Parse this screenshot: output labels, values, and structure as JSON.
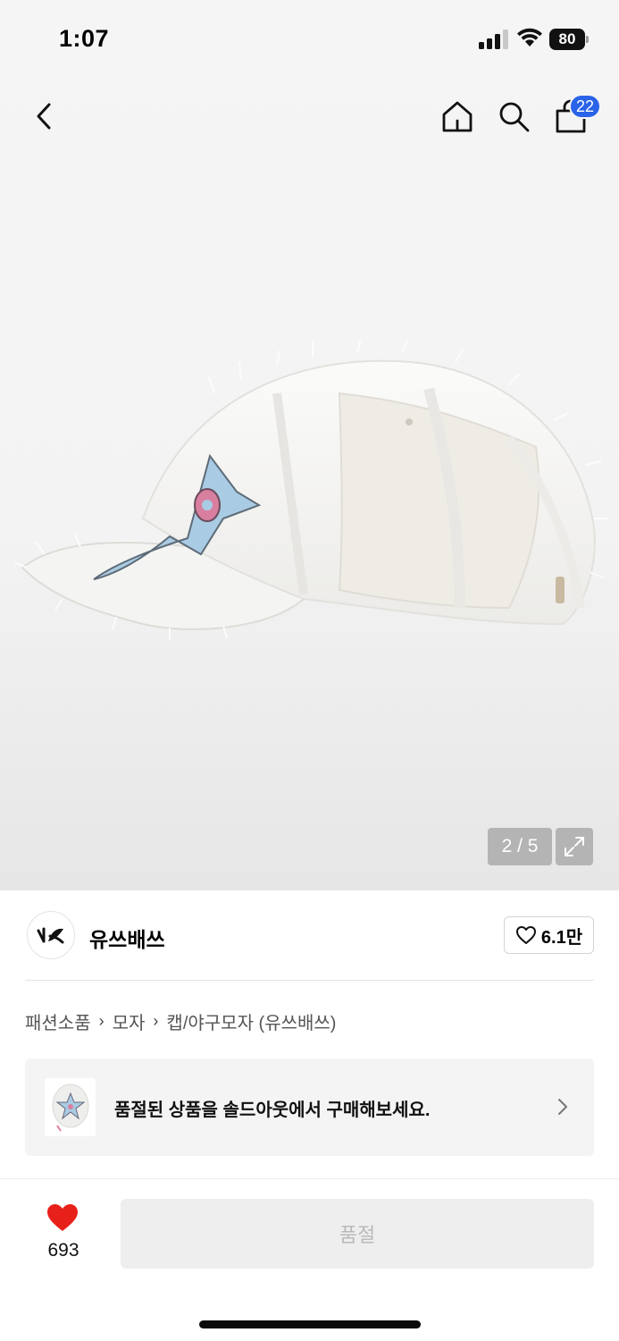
{
  "status_bar": {
    "time": "1:07",
    "battery": "80"
  },
  "nav": {
    "cart_count": "22"
  },
  "gallery": {
    "pager": "2 / 5"
  },
  "brand": {
    "name": "유쓰배쓰",
    "likes": "6.1만"
  },
  "breadcrumb": [
    "패션소품",
    "모자",
    "캡/야구모자 (유쓰배쓰)"
  ],
  "soldout_banner": {
    "text": "품절된 상품을 솔드아웃에서 구매해보세요."
  },
  "bottom_bar": {
    "wish_count": "693",
    "buy_label": "품절"
  },
  "colors": {
    "accent_blue": "#2a63e8",
    "heart_red": "#e8201a"
  }
}
